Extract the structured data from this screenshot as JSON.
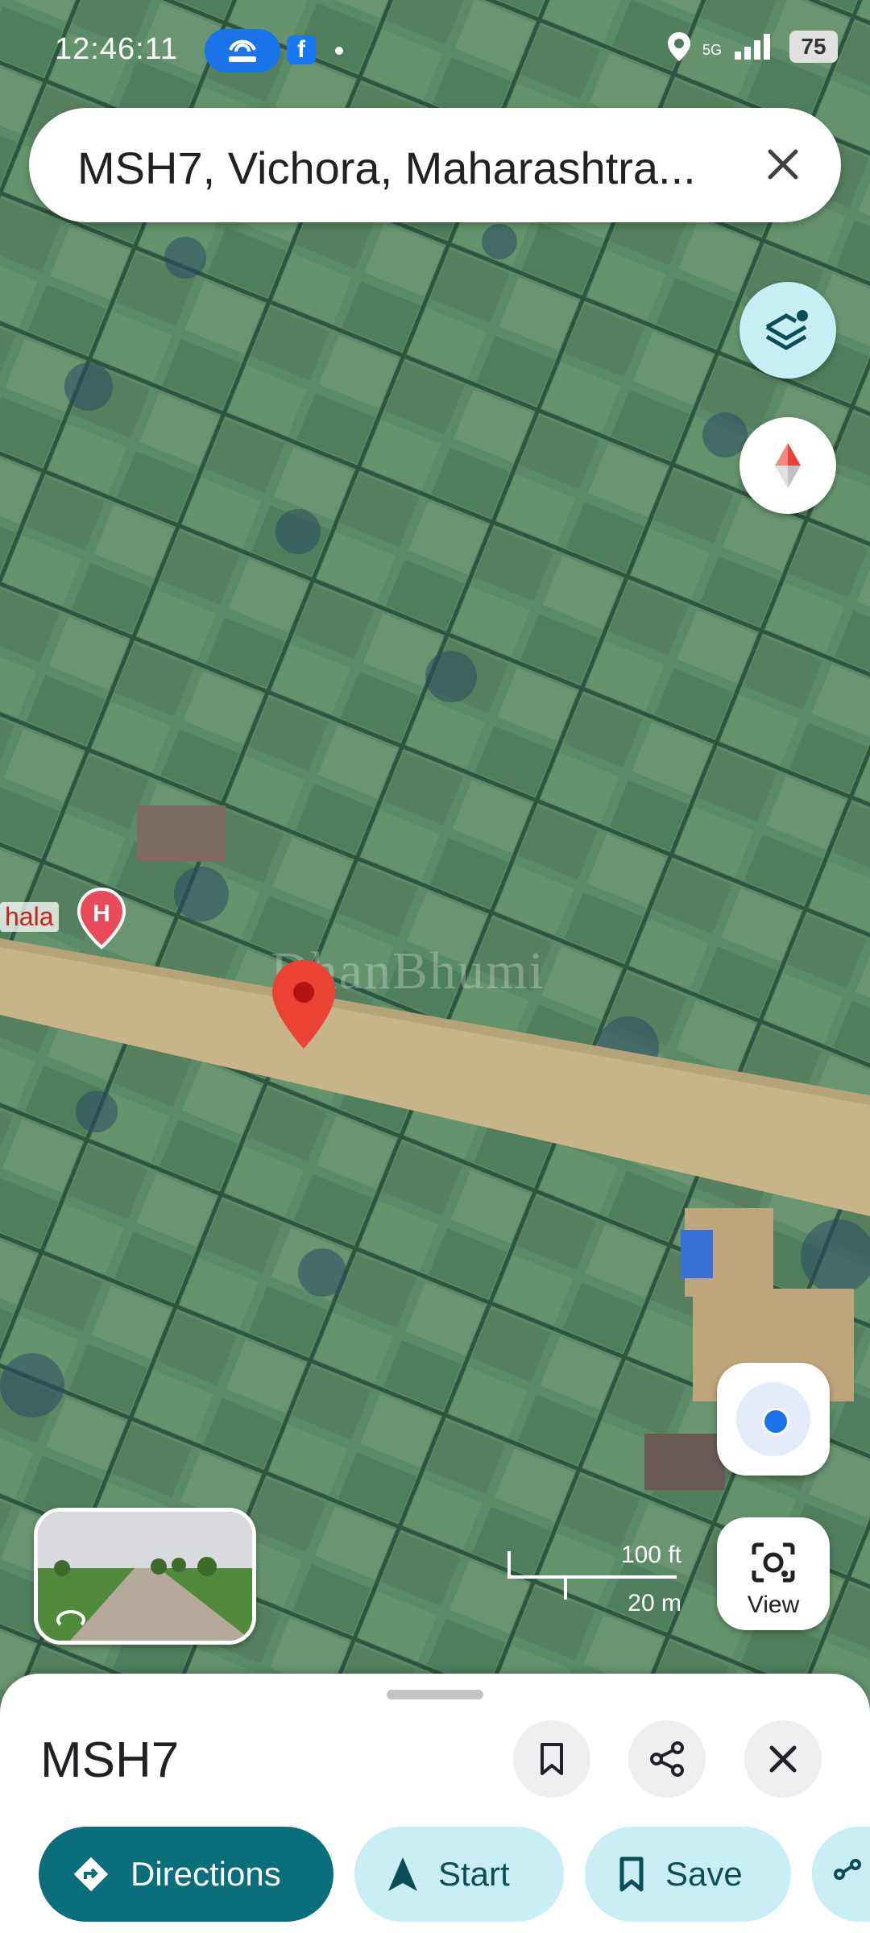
{
  "status_bar": {
    "time": "12:46:11",
    "battery": "75",
    "network": "5G"
  },
  "search": {
    "query": "MSH7, Vichora, Maharashtra..."
  },
  "map": {
    "watermark": "DhanBhumi",
    "poi_label": "hala",
    "poi_icon_letter": "H",
    "scale_ft": "100 ft",
    "scale_m": "20 m",
    "view_label": "View"
  },
  "sheet": {
    "title": "MSH7",
    "actions": {
      "directions": "Directions",
      "start": "Start",
      "save": "Save"
    }
  },
  "colors": {
    "primary": "#0b6e7b",
    "chip": "#c9eef6",
    "pin": "#ea4335",
    "location": "#1a73e8"
  }
}
